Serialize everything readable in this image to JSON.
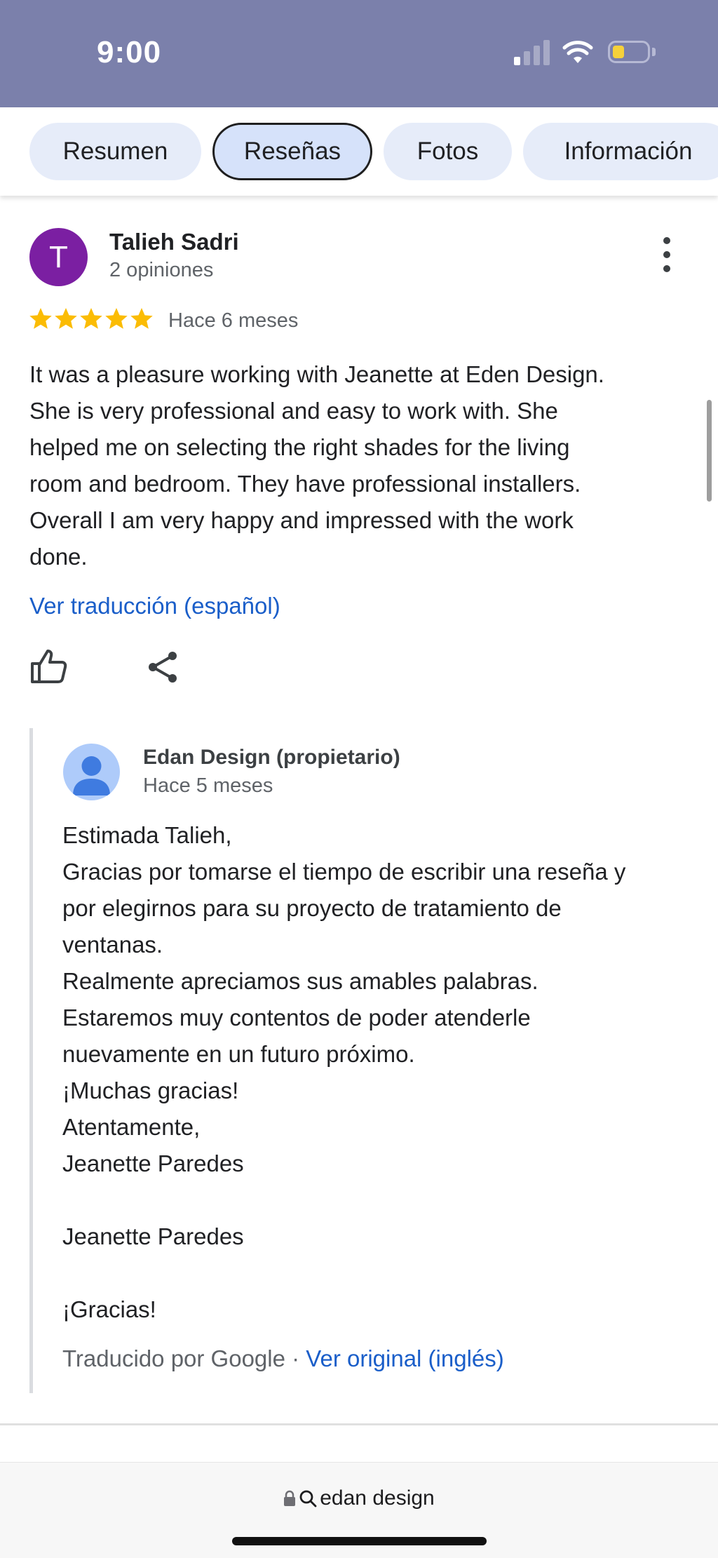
{
  "status_bar": {
    "time": "9:00",
    "battery_color": "#f6d13a",
    "bar_color": "#7b80ab"
  },
  "tabs": [
    {
      "label": "Resumen",
      "active": false
    },
    {
      "label": "Reseñas",
      "active": true
    },
    {
      "label": "Fotos",
      "active": false
    },
    {
      "label": "Información",
      "active": false
    }
  ],
  "review": {
    "avatar_letter": "T",
    "avatar_color": "#7b1fa2",
    "reviewer_name": "Talieh Sadri",
    "reviewer_count": "2 opiniones",
    "rating": 5,
    "date": "Hace 6 meses",
    "text": "It was a pleasure working with Jeanette at Eden Design.\nShe is very professional and easy to work with. She\nhelped me on selecting the right shades for the living\nroom and bedroom. They have professional installers.\nOverall I am very happy and impressed with the work\ndone.",
    "translate_link": "Ver traducción (español)",
    "icons": [
      "thumb-up-icon",
      "share-icon",
      "more-vert-icon",
      "star-icon"
    ]
  },
  "owner_reply": {
    "owner_name": "Edan Design (propietario)",
    "date": "Hace 5 meses",
    "text": "Estimada Talieh,\nGracias por tomarse el tiempo de escribir una reseña y\npor elegirnos para su proyecto de tratamiento de\nventanas.\nRealmente apreciamos sus amables palabras.\nEstaremos muy contentos de poder atenderle\nnuevamente en un futuro próximo.\n¡Muchas gracias!\nAtentamente,\nJeanette Paredes\n\nJeanette Paredes\n\n¡Gracias!",
    "translated_by": "Traducido por Google",
    "separator": " · ",
    "original_link": "Ver original (inglés)"
  },
  "bottom_bar": {
    "search_text": "edan design"
  },
  "colors": {
    "link": "#1a5ec9",
    "star": "#fbbc04",
    "tab_bg": "#e6ecf9"
  }
}
